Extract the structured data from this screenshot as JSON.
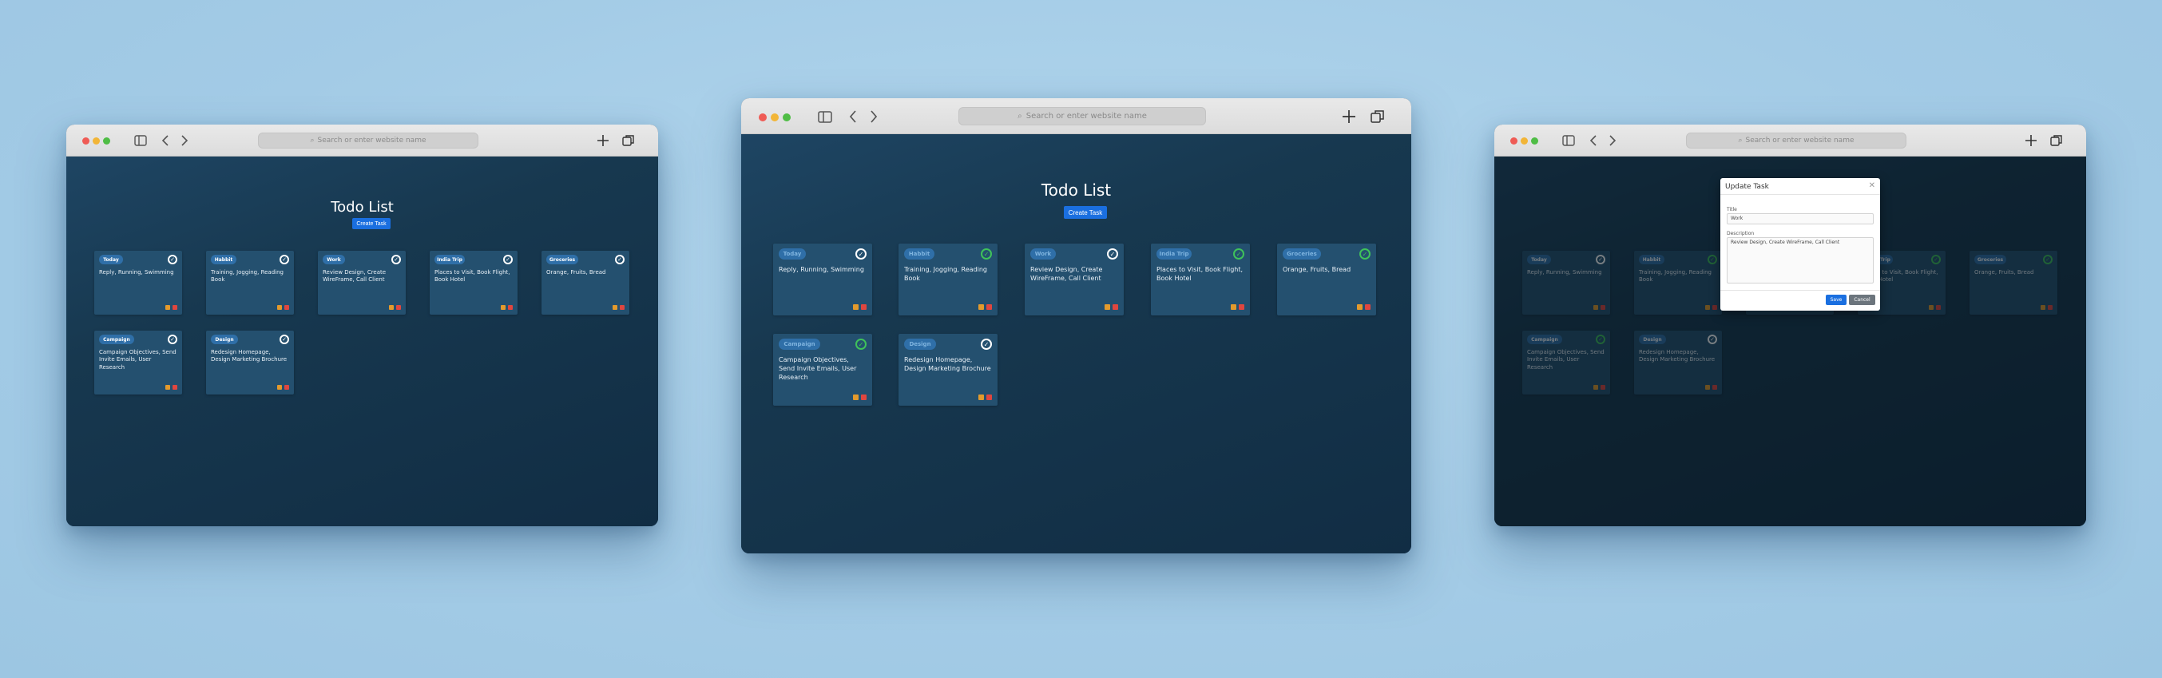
{
  "browser": {
    "address_placeholder": "Search or enter website name"
  },
  "app": {
    "title": "Todo List",
    "create_button": "Create Task"
  },
  "tasks": [
    {
      "tag": "Today",
      "description": "Reply, Running, Swimming",
      "completed": false,
      "completed_center": false
    },
    {
      "tag": "Habbit",
      "description": "Training, Jogging, Reading Book",
      "completed": false,
      "completed_center": true
    },
    {
      "tag": "Work",
      "description": "Review Design, Create WireFrame, Call Client",
      "completed": false,
      "completed_center": false
    },
    {
      "tag": "India Trip",
      "description": "Places to Visit, Book Flight, Book Hotel",
      "completed": false,
      "completed_center": true
    },
    {
      "tag": "Groceries",
      "description": "Orange, Fruits, Bread",
      "completed": false,
      "completed_center": true
    },
    {
      "tag": "Campaign",
      "description": "Campaign Objectives, Send Invite Emails, User Research",
      "completed": false,
      "completed_center": true
    },
    {
      "tag": "Design",
      "description": "Redesign Homepage, Design Marketing Brochure",
      "completed": false,
      "completed_center": false
    }
  ],
  "modal": {
    "title": "Update Task",
    "title_label": "Title",
    "title_value": "Work",
    "description_label": "Description",
    "description_value": "Review Design, Create WireFrame, Call Client",
    "save_button": "Save",
    "cancel_button": "Cancel"
  },
  "colors": {
    "background": "#a8cfe8",
    "content_bg": "#112d44",
    "card_bg": "#24506f",
    "tag_bg": "#2f6fa8",
    "button_blue": "#1a6fe0",
    "check_green": "#3fc25a"
  },
  "icons": [
    "sidebar-icon",
    "back-icon",
    "forward-icon",
    "search-icon",
    "new-tab-icon",
    "tabs-icon",
    "check-circle-icon",
    "edit-icon",
    "delete-icon",
    "close-icon"
  ]
}
